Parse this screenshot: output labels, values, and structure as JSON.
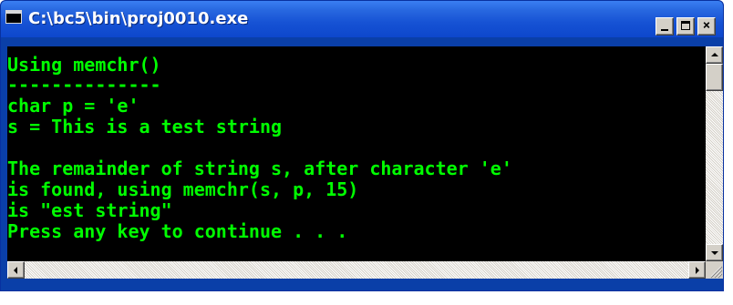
{
  "window": {
    "title": "C:\\bc5\\bin\\proj0010.exe",
    "icon": "console-app-icon",
    "controls": {
      "minimize": "minimize-icon",
      "maximize": "maximize-icon",
      "close": "close-icon",
      "close_glyph": "×"
    }
  },
  "console": {
    "text_color": "#00ff00",
    "background_color": "#000000",
    "lines": [
      "Using memchr()",
      "--------------",
      "char p = 'e'",
      "s = This is a test string",
      "",
      "The remainder of string s, after character 'e'",
      "is found, using memchr(s, p, 15)",
      "is \"est string\"",
      "Press any key to continue . . ."
    ]
  },
  "colors": {
    "titlebar": "#1652d4",
    "frame": "#0a3fa8",
    "button_face": "#d4d0c8"
  }
}
